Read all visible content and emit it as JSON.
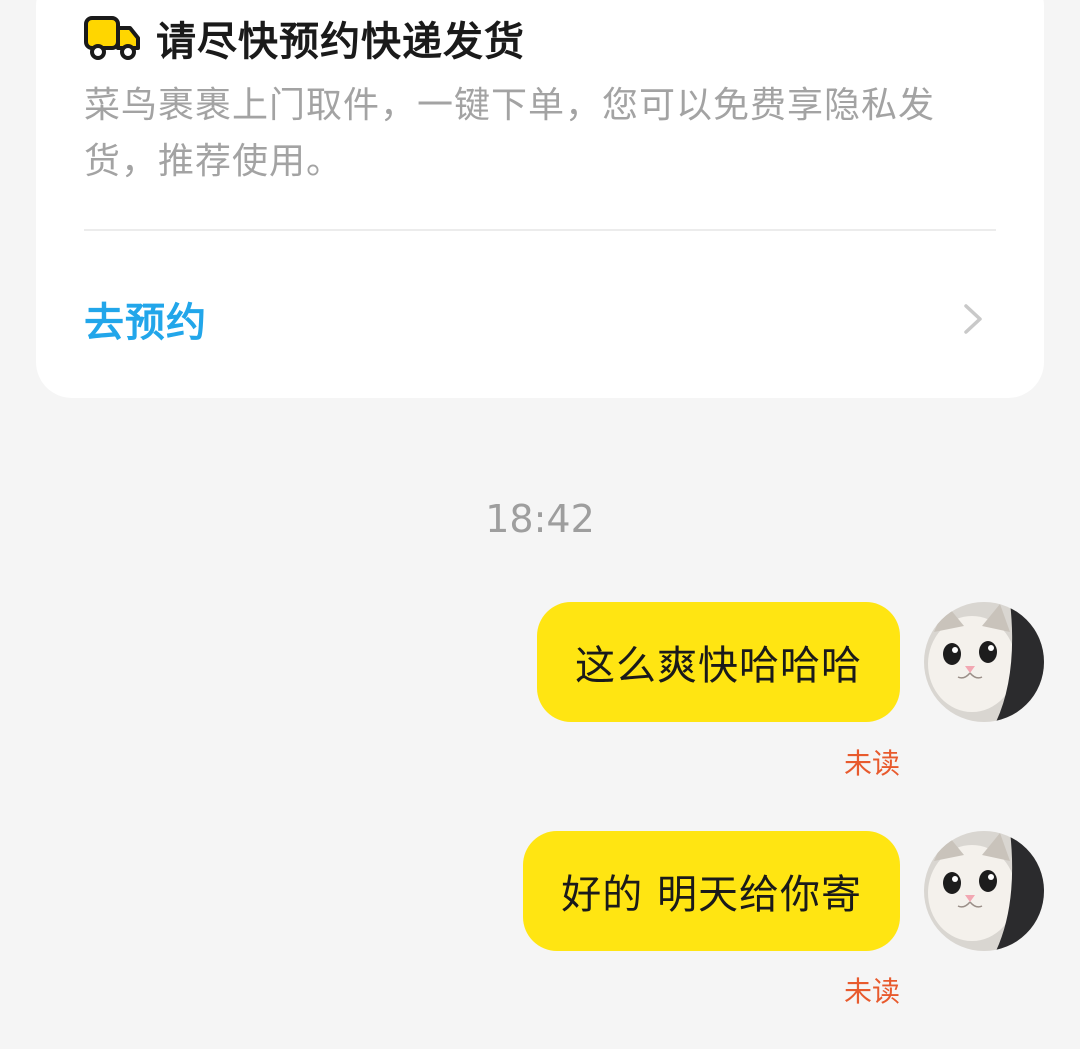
{
  "card": {
    "title": "请尽快预约快递发货",
    "description": "菜鸟裹裹上门取件，一键下单，您可以免费享隐私发货，推荐使用。",
    "action_label": "去预约",
    "icons": {
      "title_icon": "truck-icon",
      "action_icon": "chevron-right-icon"
    },
    "colors": {
      "action": "#22a6ea",
      "truck": "#ffd600"
    }
  },
  "chat": {
    "timestamp": "18:42",
    "messages": [
      {
        "text": "这么爽快哈哈哈",
        "status": "未读"
      },
      {
        "text": "好的 明天给你寄",
        "status": "未读"
      }
    ],
    "colors": {
      "bubble": "#ffe512",
      "unread": "#e85a2d"
    }
  }
}
